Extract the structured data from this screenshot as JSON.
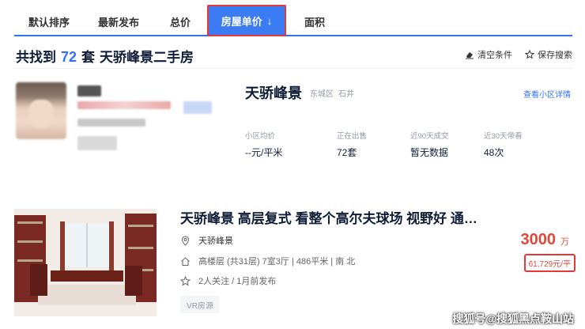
{
  "tabs": [
    {
      "label": "默认排序"
    },
    {
      "label": "最新发布"
    },
    {
      "label": "总价"
    },
    {
      "label": "房屋单价",
      "arrow": "↓"
    },
    {
      "label": "面积"
    }
  ],
  "results": {
    "prefix": "共找到",
    "count": "72",
    "suffix": "套",
    "community": "天骄峰景二手房"
  },
  "tools": {
    "clear_label": "清空条件",
    "save_label": "保存搜索"
  },
  "community": {
    "name": "天骄峰景",
    "district": "东城区",
    "area": "石井",
    "detail_link": "查看小区详情",
    "stats": [
      {
        "label": "小区均价",
        "value": "--元/平米"
      },
      {
        "label": "正在出售",
        "value": "72套"
      },
      {
        "label": "近90天成交",
        "value": "暂无数据"
      },
      {
        "label": "近30天带看",
        "value": "48次"
      }
    ]
  },
  "listing": {
    "title": "天骄峰景 高层复式 看整个高尔夫球场 视野好 通…",
    "community": "天骄峰景",
    "detail": "高楼层 (共31层) 7室3厅 | 486平米 | 南 北",
    "followers": "2人关注 / 1月前发布",
    "tag": "VR房源",
    "total_price": "3000",
    "total_unit": "万",
    "unit_price": "61,729元/平"
  },
  "watermark": "搜狐号@搜狐黑点鞍山站",
  "colors": {
    "accent": "#3072f6",
    "price": "#e0483a",
    "highlight_border": "#e53935"
  }
}
